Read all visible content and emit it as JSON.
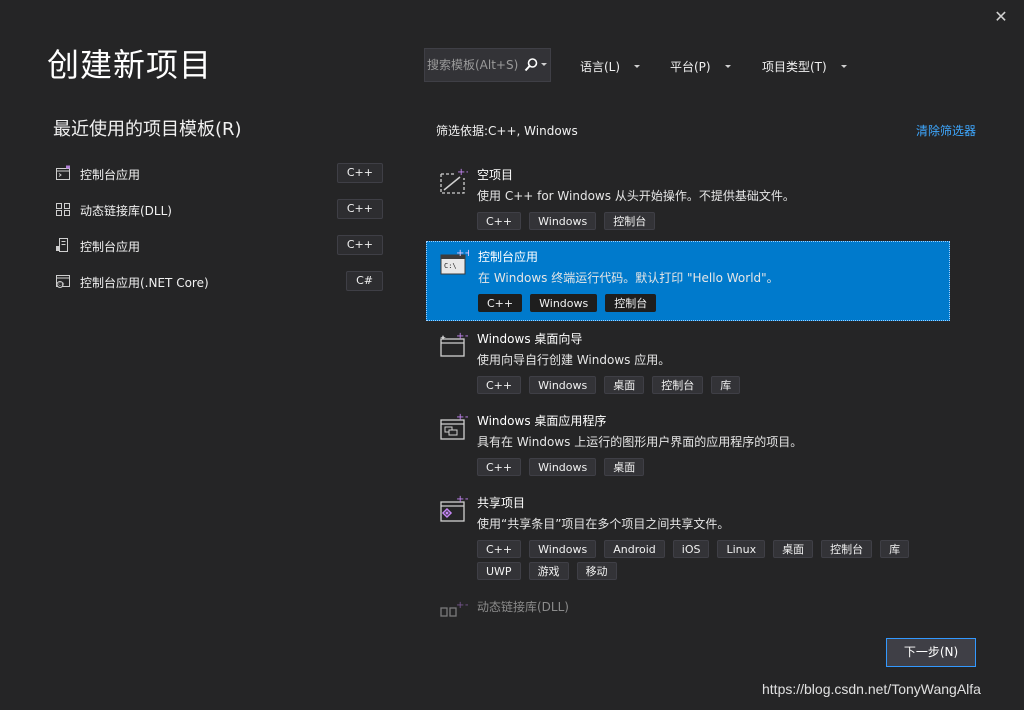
{
  "window": {
    "close_label": "✕"
  },
  "header": {
    "title": "创建新项目",
    "search": {
      "placeholder": "搜索模板(Alt+S)",
      "value": ""
    },
    "filters": [
      {
        "label": "语言(L)"
      },
      {
        "label": "平台(P)"
      },
      {
        "label": "项目类型(T)"
      }
    ]
  },
  "recent": {
    "title": "最近使用的项目模板(R)",
    "items": [
      {
        "label": "控制台应用",
        "lang": "C++",
        "icon": "console-app-icon"
      },
      {
        "label": "动态链接库(DLL)",
        "lang": "C++",
        "icon": "dll-icon"
      },
      {
        "label": "控制台应用",
        "lang": "C++",
        "icon": "console-app-icon"
      },
      {
        "label": "控制台应用(.NET Core)",
        "lang": "C#",
        "icon": "dotnet-console-icon"
      }
    ]
  },
  "templates_panel": {
    "filter_status": "筛选依据:C++, Windows",
    "clear_label": "清除筛选器",
    "templates": [
      {
        "name": "空项目",
        "desc": "使用 C++ for Windows 从头开始操作。不提供基础文件。",
        "tags": [
          "C++",
          "Windows",
          "控制台"
        ],
        "icon": "empty-project-icon"
      },
      {
        "name": "控制台应用",
        "desc": "在 Windows 终端运行代码。默认打印 \"Hello World\"。",
        "tags": [
          "C++",
          "Windows",
          "控制台"
        ],
        "icon": "console-app-icon"
      },
      {
        "name": "Windows 桌面向导",
        "desc": "使用向导自行创建 Windows 应用。",
        "tags": [
          "C++",
          "Windows",
          "桌面",
          "控制台",
          "库"
        ],
        "icon": "desktop-wizard-icon"
      },
      {
        "name": "Windows 桌面应用程序",
        "desc": "具有在 Windows 上运行的图形用户界面的应用程序的项目。",
        "tags": [
          "C++",
          "Windows",
          "桌面"
        ],
        "icon": "desktop-app-icon"
      },
      {
        "name": "共享项目",
        "desc": "使用“共享条目”项目在多个项目之间共享文件。",
        "tags": [
          "C++",
          "Windows",
          "Android",
          "iOS",
          "Linux",
          "桌面",
          "控制台",
          "库",
          "UWP",
          "游戏",
          "移动"
        ],
        "icon": "shared-project-icon"
      },
      {
        "name": "动态链接库(DLL)",
        "desc": "",
        "tags": [],
        "icon": "dll-icon"
      }
    ]
  },
  "footer": {
    "next_label": "下一步(N)"
  },
  "watermark": "https://blog.csdn.net/TonyWangAlfa",
  "colors": {
    "accent": "#007acc",
    "background": "#252526",
    "link": "#3ea8ff"
  }
}
